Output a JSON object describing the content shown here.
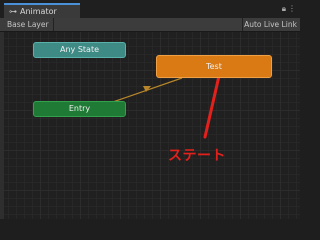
{
  "window": {
    "tab_icon": "graph-icon",
    "tab_title": "Animator"
  },
  "toolbar": {
    "layer_tab": "Base Layer",
    "live_link": "Auto Live Link"
  },
  "nodes": {
    "any_state": "Any State",
    "entry": "Entry",
    "test": "Test"
  },
  "annotation": {
    "label": "ステート"
  },
  "colors": {
    "accent": "#4a90d9",
    "any_state": "#3e8b86",
    "entry": "#1f7a35",
    "state": "#d97a14",
    "annotation": "#e3201c",
    "transition": "#b8862a"
  }
}
